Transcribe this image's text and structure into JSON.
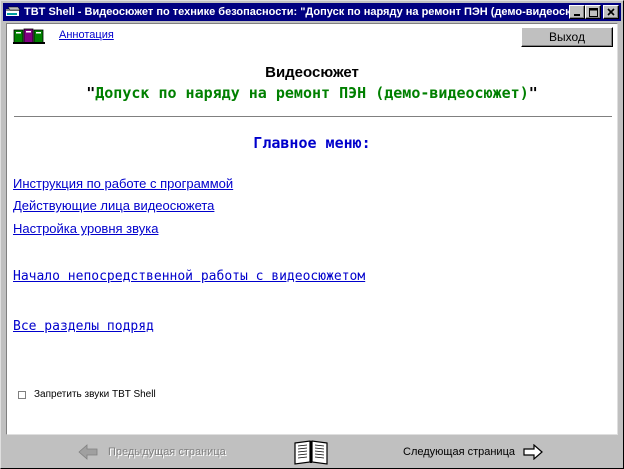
{
  "window": {
    "title": "TBT Shell - Видеосюжет по технике безопасности: \"Допуск по наряду на ремонт ПЭН (демо-видеосюжет)\".",
    "minimize_label": "_",
    "maximize_label": "□",
    "close_label": "✕"
  },
  "toolbar": {
    "annotation_link": "Аннотация",
    "exit_button": "Выход"
  },
  "header": {
    "heading": "Видеосюжет",
    "quote_open": "\"",
    "subtitle": "Допуск по наряду на ремонт ПЭН (демо-видеосюжет)",
    "quote_close": "\""
  },
  "main_menu": {
    "heading": "Главное меню:",
    "links": [
      "Инструкция по работе с программой",
      "Действующие лица видеосюжета",
      "Настройка уровня звука",
      "Начало непосредственной работы с видеосюжетом",
      "Все разделы подряд"
    ]
  },
  "options": {
    "mute_sounds_label": "Запретить звуки TBT Shell",
    "mute_sounds_checked": false
  },
  "navigation": {
    "prev_label": "Предыдущая страница",
    "next_label": "Следующая страница"
  },
  "colors": {
    "title_bar": "#000080",
    "link": "#0000cc",
    "subtitle_green": "#008000",
    "disabled_text": "#808080"
  }
}
